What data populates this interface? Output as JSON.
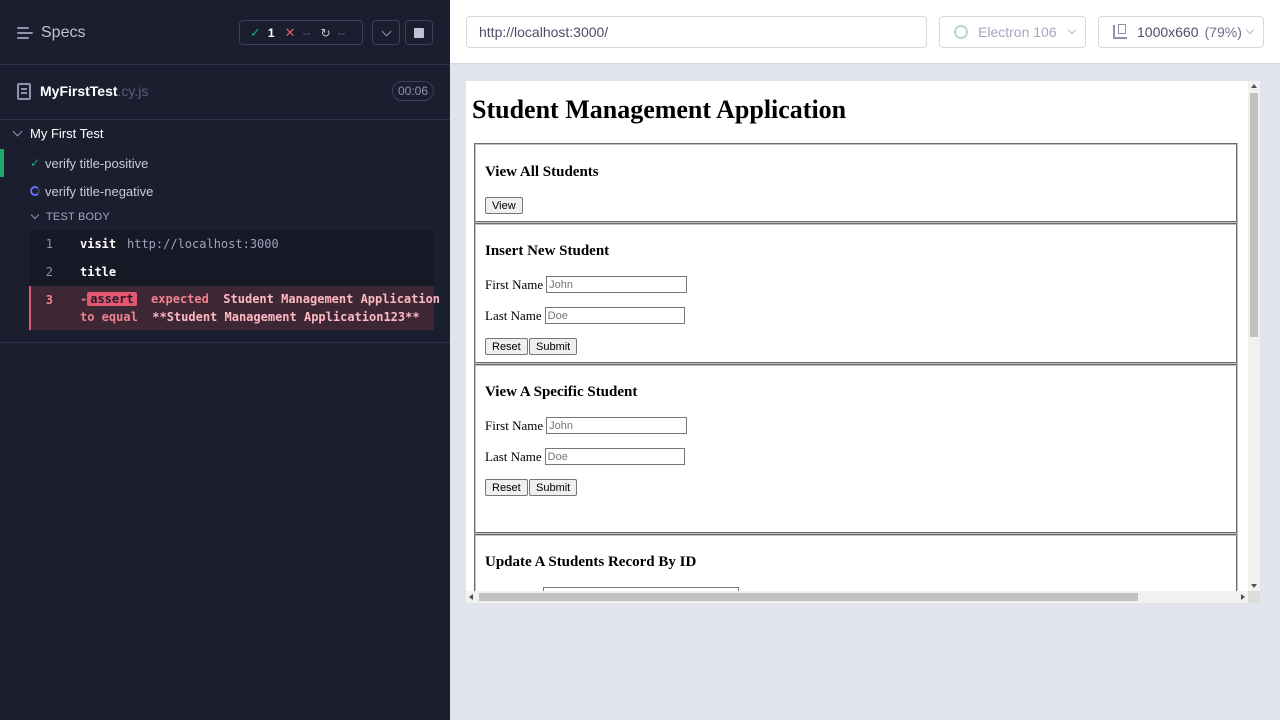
{
  "reporter": {
    "specs_label": "Specs",
    "stats": {
      "passed": "1",
      "failed": "--",
      "pending": "--"
    },
    "spec_file": {
      "name": "MyFirstTest",
      "ext": ".cy.js",
      "duration": "00:06"
    },
    "suite": "My First Test",
    "tests": [
      {
        "title": "verify title-positive",
        "state": "passed"
      },
      {
        "title": "verify title-negative",
        "state": "running"
      }
    ],
    "test_body_label": "TEST BODY",
    "commands": [
      {
        "num": "1",
        "name": "visit",
        "arg": "http://localhost:3000"
      },
      {
        "num": "2",
        "name": "title",
        "arg": ""
      },
      {
        "num": "3",
        "prefix": "-",
        "name": "assert",
        "word1": "expected",
        "value1": "Student Management Application",
        "word2": "to equal",
        "value2": "**Student Management Application123**"
      }
    ],
    "colors": {
      "passed": "#1fa971",
      "failed": "#e45770",
      "bg": "#1b1e2e"
    }
  },
  "aut": {
    "url": "http://localhost:3000/",
    "browser": "Electron 106",
    "viewport": "1000x660",
    "scale": "(79%)"
  },
  "app": {
    "title": "Student Management Application",
    "sections": [
      {
        "heading": "View All Students",
        "button": "View"
      },
      {
        "heading": "Insert New Student",
        "first_label": "First Name",
        "first_placeholder": "John",
        "last_label": "Last Name",
        "last_placeholder": "Doe",
        "reset": "Reset",
        "submit": "Submit"
      },
      {
        "heading": "View A Specific Student",
        "first_label": "First Name",
        "first_placeholder": "John",
        "last_label": "Last Name",
        "last_placeholder": "Doe",
        "reset": "Reset",
        "submit": "Submit"
      },
      {
        "heading": "Update A Students Record By ID"
      }
    ]
  }
}
